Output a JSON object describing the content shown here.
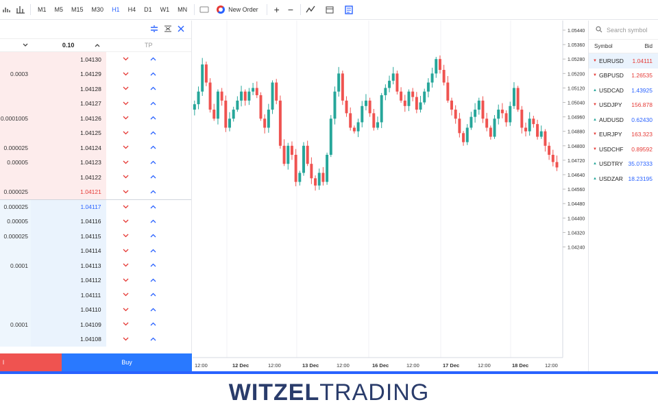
{
  "toolbar": {
    "timeframes": [
      "M1",
      "M5",
      "M15",
      "M30",
      "H1",
      "H4",
      "D1",
      "W1",
      "MN"
    ],
    "active_timeframe": "H1",
    "new_order_label": "New Order",
    "zoom_in": "+",
    "zoom_out": "−"
  },
  "dom": {
    "header_volume": "0.10",
    "header_tp": "TP",
    "rows": [
      {
        "vol": "",
        "price": "1.04130",
        "side": "ask"
      },
      {
        "vol": "0.0003",
        "price": "1.04129",
        "side": "ask"
      },
      {
        "vol": "",
        "price": "1.04128",
        "side": "ask"
      },
      {
        "vol": "",
        "price": "1.04127",
        "side": "ask"
      },
      {
        "vol": "0.0001005",
        "price": "1.04126",
        "side": "ask"
      },
      {
        "vol": "",
        "price": "1.04125",
        "side": "ask"
      },
      {
        "vol": "0.000025",
        "price": "1.04124",
        "side": "ask"
      },
      {
        "vol": "0.00005",
        "price": "1.04123",
        "side": "ask"
      },
      {
        "vol": "",
        "price": "1.04122",
        "side": "ask"
      },
      {
        "vol": "0.000025",
        "price": "1.04121",
        "side": "ask",
        "highlight": "red"
      },
      {
        "vol": "0.000025",
        "price": "1.04117",
        "side": "bid",
        "highlight": "blue"
      },
      {
        "vol": "0.00005",
        "price": "1.04116",
        "side": "bid"
      },
      {
        "vol": "0.000025",
        "price": "1.04115",
        "side": "bid"
      },
      {
        "vol": "",
        "price": "1.04114",
        "side": "bid"
      },
      {
        "vol": "0.0001",
        "price": "1.04113",
        "side": "bid"
      },
      {
        "vol": "",
        "price": "1.04112",
        "side": "bid"
      },
      {
        "vol": "",
        "price": "1.04111",
        "side": "bid"
      },
      {
        "vol": "",
        "price": "1.04110",
        "side": "bid"
      },
      {
        "vol": "0.0001",
        "price": "1.04109",
        "side": "bid"
      },
      {
        "vol": "",
        "price": "1.04108",
        "side": "bid"
      }
    ],
    "sell_label": "l",
    "buy_label": "Buy"
  },
  "chart": {
    "price_labels": [
      "1.05440",
      "1.05360",
      "1.05280",
      "1.05200",
      "1.05120",
      "1.05040",
      "1.04960",
      "1.04880",
      "1.04800",
      "1.04720",
      "1.04640",
      "1.04560",
      "1.04480",
      "1.04400",
      "1.04320",
      "1.04240"
    ],
    "time_labels": [
      {
        "t": "12:00",
        "bold": false
      },
      {
        "t": "12 Dec",
        "bold": true
      },
      {
        "t": "12:00",
        "bold": false
      },
      {
        "t": "13 Dec",
        "bold": true
      },
      {
        "t": "12:00",
        "bold": false
      },
      {
        "t": "16 Dec",
        "bold": true
      },
      {
        "t": "12:00",
        "bold": false
      },
      {
        "t": "17 Dec",
        "bold": true
      },
      {
        "t": "12:00",
        "bold": false
      },
      {
        "t": "18 Dec",
        "bold": true
      },
      {
        "t": "12:00",
        "bold": false
      }
    ],
    "up_color": "#26a69a",
    "down_color": "#ef5350"
  },
  "watchlist": {
    "search_placeholder": "Search symbol",
    "col_symbol": "Symbol",
    "col_bid": "Bid",
    "rows": [
      {
        "symbol": "EURUSD",
        "bid": "1.04111",
        "dir": "down"
      },
      {
        "symbol": "GBPUSD",
        "bid": "1.26535",
        "dir": "down"
      },
      {
        "symbol": "USDCAD",
        "bid": "1.43925",
        "dir": "up"
      },
      {
        "symbol": "USDJPY",
        "bid": "156.878",
        "dir": "down"
      },
      {
        "symbol": "AUDUSD",
        "bid": "0.62430",
        "dir": "up"
      },
      {
        "symbol": "EURJPY",
        "bid": "163.323",
        "dir": "down"
      },
      {
        "symbol": "USDCHF",
        "bid": "0.89592",
        "dir": "down"
      },
      {
        "symbol": "USDTRY",
        "bid": "35.07333",
        "dir": "up"
      },
      {
        "symbol": "USDZAR",
        "bid": "18.23195",
        "dir": "up"
      }
    ]
  },
  "footer": {
    "brand_bold": "WITZEL",
    "brand_light": "TRADING"
  }
}
